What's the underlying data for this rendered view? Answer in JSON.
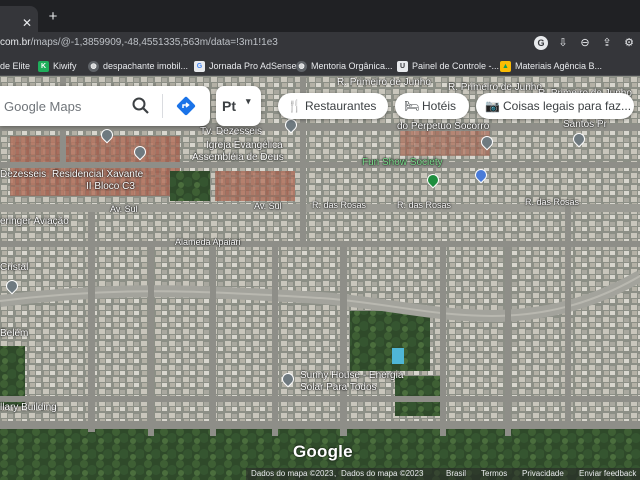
{
  "browser": {
    "tab_close": "✕",
    "new_tab": "+",
    "url_host": "com.br",
    "url_path": "/maps/@-1,3859909,-48,4551335,563m/data=!3m1!1e3",
    "bookmarks": [
      {
        "label": "de Elite",
        "icon": "",
        "color": ""
      },
      {
        "label": "Kiwify",
        "icon": "kiwify-icon",
        "color": "#1fae5b"
      },
      {
        "label": "despachante imobil...",
        "icon": "globe-icon",
        "color": "#5f6368"
      },
      {
        "label": "Jornada Pro AdSense",
        "icon": "google-icon",
        "color": "#e8eaed"
      },
      {
        "label": "Mentoria Orgânica...",
        "icon": "globe-icon",
        "color": "#5f6368"
      },
      {
        "label": "Painel de Controle -...",
        "icon": "shield-icon",
        "color": "#e8eaed"
      },
      {
        "label": "Materiais Agência B...",
        "icon": "drive-icon",
        "color": "#fbbc04"
      }
    ]
  },
  "search": {
    "placeholder": "Google Maps",
    "profile_label": "Pt"
  },
  "chips": [
    {
      "label": "Restaurantes",
      "icon": "fork-knife-icon"
    },
    {
      "label": "Hotéis",
      "icon": "bed-icon"
    },
    {
      "label": "Coisas legais para faz...",
      "icon": "camera-icon"
    }
  ],
  "map_labels": {
    "street_primeiro_junho_1": "R. Primeiro de Junho",
    "street_primeiro_junho_2": "R. Primeiro de Junho",
    "street_primeiro_junho_3": "R. Primeiro de Junho",
    "perpetuo_socorro": "do Perpetuo Socorro",
    "santos": "Santos Pr",
    "dezesseis_1": "Tv. Dezesseis",
    "dezesseis_2": "Dezesseis",
    "igreja": "Igreja Evangélica",
    "assembleia": "Assembléia de Deus",
    "fun_show": "Fun Show Society",
    "residencial_1": "Residencial Xavante",
    "residencial_2": "II Bloco C3",
    "av_sul_1": "Av. Sul",
    "av_sul_2": "Av. Sul",
    "rosas_1": "R. das Rosas",
    "rosas_2": "R. das Rosas",
    "rosas_3": "R. das Rosas",
    "aviacao": "eringer Aviação",
    "alameda": "Alameda Apaiari",
    "cristal": "Cristal",
    "belem": "Belém",
    "sunny_1": "Sunny House - Energia",
    "sunny_2": "Solar Para Todos",
    "building": "llary Building"
  },
  "logo": "Google",
  "attribution": {
    "data1": "Dados do mapa ©2023",
    "separator": ",",
    "data2": "Dados do mapa ©2023",
    "country": "Brasil",
    "terms": "Termos",
    "privacy": "Privacidade",
    "feedback": "Enviar feedback"
  }
}
